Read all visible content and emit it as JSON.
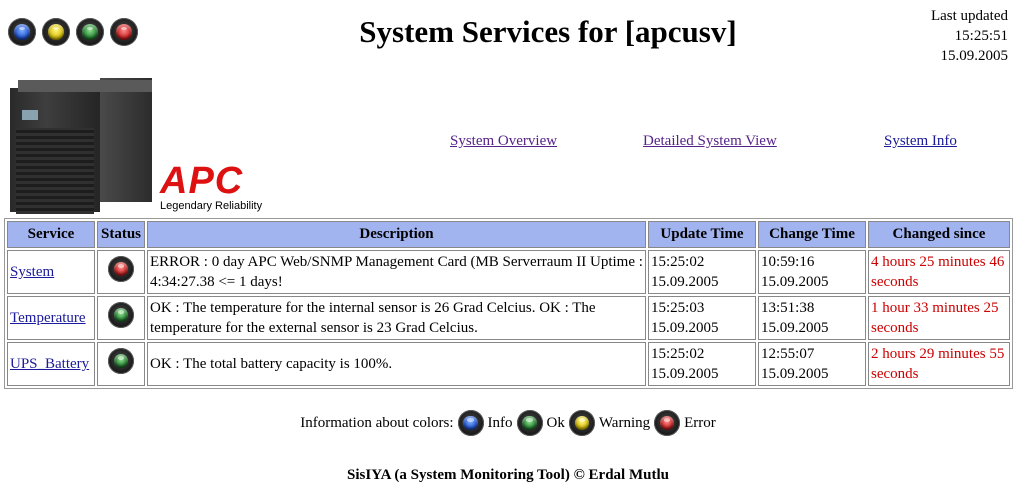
{
  "header": {
    "title": "System Services for [apcusv]",
    "last_updated_label": "Last updated",
    "last_updated_time": "15:25:51",
    "last_updated_date": "15.09.2005",
    "icons": [
      "blue-status-icon",
      "yellow-status-icon",
      "green-status-icon",
      "red-status-icon"
    ]
  },
  "brand": {
    "logo": "APC",
    "tagline": "Legendary Reliability"
  },
  "nav": {
    "overview": "System Overview",
    "detailed": "Detailed System View",
    "info": "System Info"
  },
  "table": {
    "headers": [
      "Service",
      "Status",
      "Description",
      "Update Time",
      "Change Time",
      "Changed since"
    ],
    "rows": [
      {
        "service": "System",
        "status": "error",
        "description": "ERROR : 0 day APC Web/SNMP Management Card (MB Serverraum II Uptime : 4:34:27.38 <= 1 days!",
        "update_time": "15:25:02",
        "update_date": "15.09.2005",
        "change_time": "10:59:16",
        "change_date": "15.09.2005",
        "changed_since": "4 hours 25 minutes 46 seconds"
      },
      {
        "service": "Temperature",
        "status": "ok",
        "description": "OK : The temperature for the internal sensor is 26 Grad Celcius. OK : The temperature for the external sensor is 23 Grad Celcius.",
        "update_time": "15:25:03",
        "update_date": "15.09.2005",
        "change_time": "13:51:38",
        "change_date": "15.09.2005",
        "changed_since": "1 hour 33 minutes 25 seconds"
      },
      {
        "service": "UPS_Battery",
        "status": "ok",
        "description": "OK : The total battery capacity is 100%.",
        "update_time": "15:25:02",
        "update_date": "15.09.2005",
        "change_time": "12:55:07",
        "change_date": "15.09.2005",
        "changed_since": "2 hours 29 minutes 55 seconds"
      }
    ]
  },
  "legend": {
    "label": "Information about colors:",
    "info": "Info",
    "ok": "Ok",
    "warning": "Warning",
    "error": "Error"
  },
  "footer": {
    "text": "SisIYA (a System Monitoring Tool) © Erdal Mutlu"
  },
  "colors": {
    "header_bg": "#a2b4f0",
    "changed_text": "#cc0000",
    "link": "#1a1a9a",
    "brand_red": "#dd1111"
  }
}
